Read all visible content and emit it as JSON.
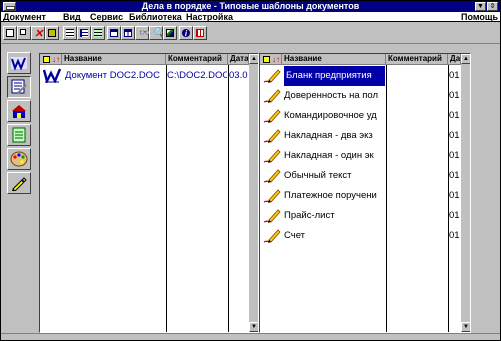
{
  "window": {
    "title": "Дела в порядке - Типовые шаблоны документов"
  },
  "menu": {
    "items": [
      {
        "label": "Документ"
      },
      {
        "label": "Вид"
      },
      {
        "label": "Сервис"
      },
      {
        "label": "Библиотека"
      },
      {
        "label": "Настройка"
      }
    ],
    "help": "Помощь"
  },
  "toolbar": {
    "buttons": [
      "new-doc-icon",
      "copy-doc-icon",
      "delete-icon",
      "open-folder-icon",
      "list-view-icon",
      "tree-view-icon",
      "detail-view-icon",
      "window-icon",
      "window-split-icon",
      "binoculars-icon",
      "search-icon",
      "picture-icon",
      "info-icon",
      "calendar-icon"
    ]
  },
  "left_panel": {
    "columns": [
      "Название",
      "Комментарий",
      "Дата"
    ],
    "rows": [
      {
        "name": "Документ DOC2.DOC",
        "comment": "C:\\DOC2.DOC",
        "date": "03.0",
        "icon": "word-doc-icon"
      }
    ]
  },
  "right_panel": {
    "columns": [
      "Название",
      "Комментарий",
      "Дата"
    ],
    "selected_index": 0,
    "rows": [
      {
        "name": "Бланк предприятия",
        "comment": "",
        "date": "01"
      },
      {
        "name": "Доверенность на пол",
        "comment": "",
        "date": "01"
      },
      {
        "name": "Командировочное уд",
        "comment": "",
        "date": "01"
      },
      {
        "name": "Накладная - два экз",
        "comment": "",
        "date": "01"
      },
      {
        "name": "Накладная - один эк",
        "comment": "",
        "date": "01"
      },
      {
        "name": "Обычный текст",
        "comment": "",
        "date": "01"
      },
      {
        "name": "Платежное поручени",
        "comment": "",
        "date": "01"
      },
      {
        "name": "Прайс-лист",
        "comment": "",
        "date": "01"
      },
      {
        "name": "Счет",
        "comment": "",
        "date": "01"
      }
    ]
  },
  "colors": {
    "titlebar": "#000080",
    "selection": "#0000a8",
    "link_text": "#0000a8",
    "face": "#c0c0c0"
  }
}
